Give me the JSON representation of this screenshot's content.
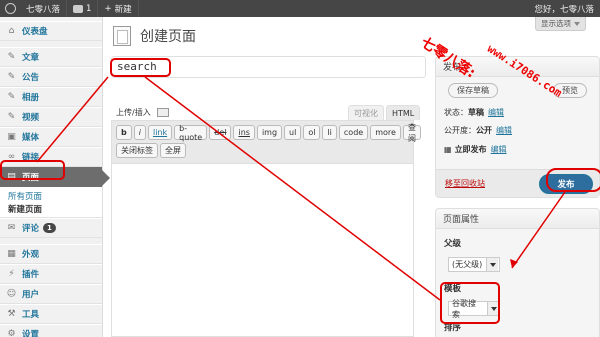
{
  "adminbar": {
    "site_name": "七零八落",
    "comments_count": "1",
    "new_label": "新建",
    "greeting": "您好，七零八落"
  },
  "sidebar": {
    "items": [
      {
        "label": "仪表盘",
        "icon": "dashboard-icon"
      },
      {
        "label": "文章",
        "icon": "pin-icon"
      },
      {
        "label": "公告",
        "icon": "pin-icon"
      },
      {
        "label": "相册",
        "icon": "pin-icon"
      },
      {
        "label": "视频",
        "icon": "pin-icon"
      },
      {
        "label": "媒体",
        "icon": "media-icon"
      },
      {
        "label": "链接",
        "icon": "link-icon"
      },
      {
        "label": "页面",
        "icon": "page-icon"
      },
      {
        "label": "评论",
        "icon": "comment-icon",
        "badge": "1"
      },
      {
        "label": "外观",
        "icon": "appearance-icon"
      },
      {
        "label": "插件",
        "icon": "plugin-icon"
      },
      {
        "label": "用户",
        "icon": "users-icon"
      },
      {
        "label": "工具",
        "icon": "tools-icon"
      },
      {
        "label": "设置",
        "icon": "settings-icon"
      }
    ],
    "submenu": [
      "所有页面",
      "新建页面"
    ]
  },
  "main": {
    "title": "创建页面",
    "title_value": "search",
    "upload_label": "上传/插入",
    "tabs": [
      "可视化",
      "HTML"
    ],
    "toolbar_row1": [
      "b",
      "i",
      "link",
      "b-quote",
      "del",
      "ins",
      "img",
      "ul",
      "ol",
      "li",
      "code",
      "more",
      "查阅"
    ],
    "toolbar_row2": [
      "关闭标签",
      "全屏"
    ]
  },
  "right": {
    "screen_options": "显示选项",
    "publish": {
      "heading": "发布",
      "save_draft": "保存草稿",
      "preview": "预览",
      "status_label": "状态：",
      "status_value": "草稿",
      "visibility_label": "公开度：",
      "visibility_value": "公开",
      "edit": "编辑",
      "publish_now": "立即发布",
      "trash": "移至回收站",
      "publish_button": "发布"
    },
    "attributes": {
      "heading": "页面属性",
      "parent_label": "父级",
      "parent_value": "(无父级)",
      "template_label": "模板",
      "template_value": "谷歌搜索",
      "order_label": "排序"
    }
  },
  "watermark": {
    "line1": "七零八落:",
    "line2": "www.i7086.com"
  },
  "colors": {
    "accent": "#21759b",
    "admin_bar": "#464646",
    "annotation": "#e10000",
    "primary_button": "#2e6e9e"
  }
}
